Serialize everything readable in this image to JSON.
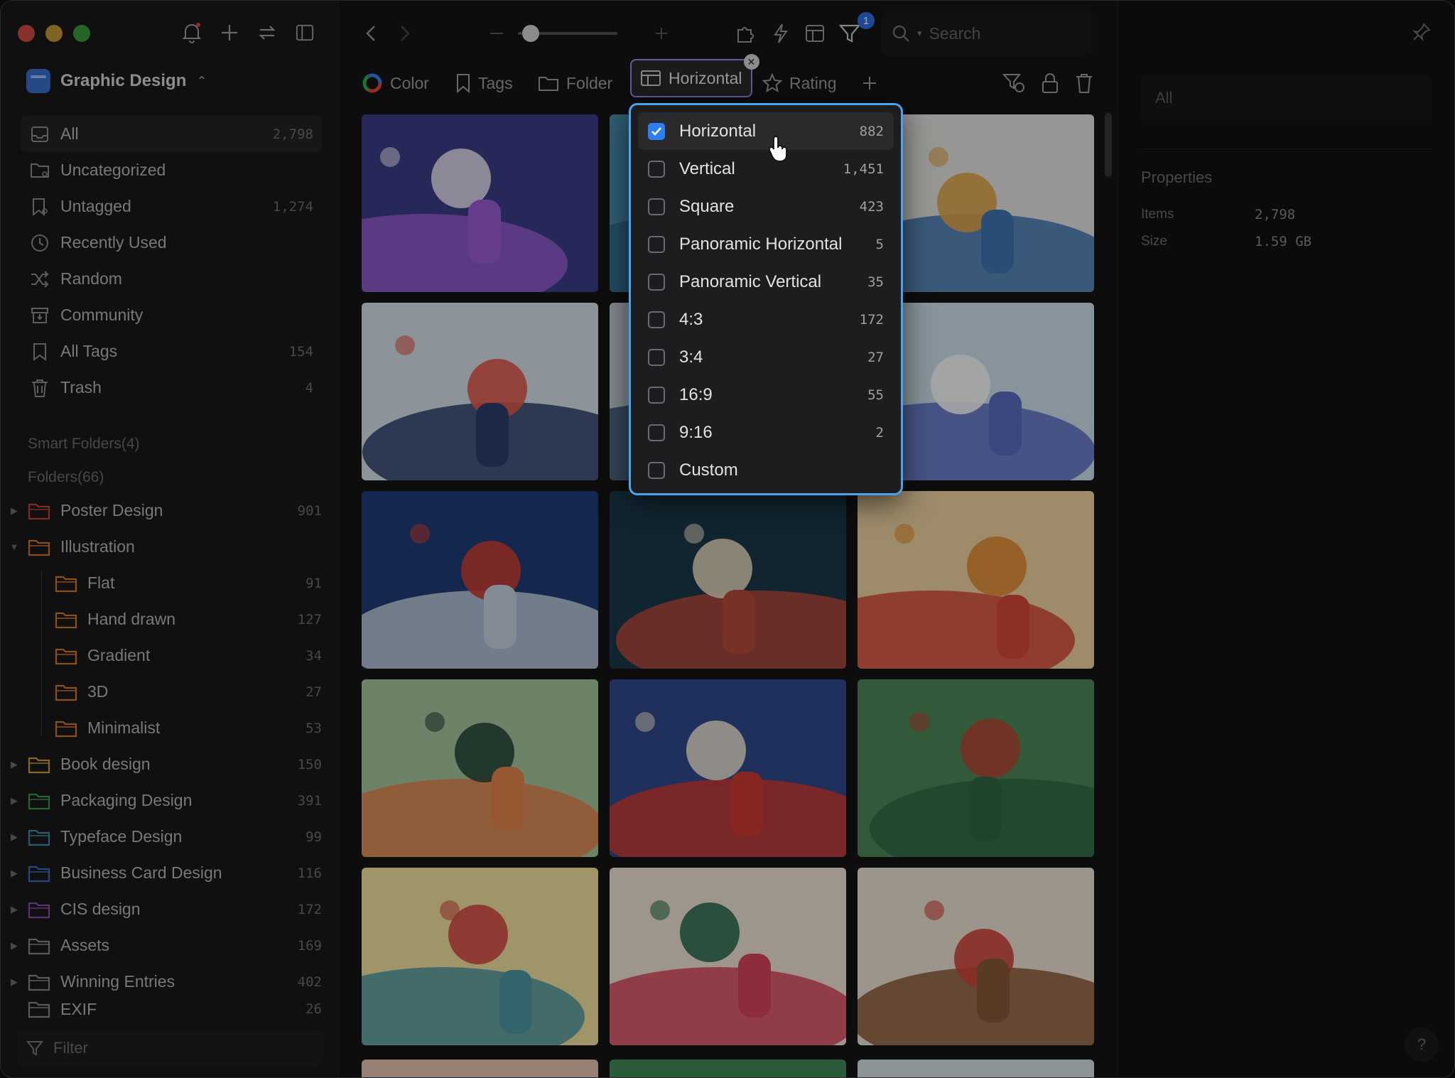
{
  "library": {
    "name": "Graphic Design"
  },
  "nav": [
    {
      "icon": "inbox-icon",
      "label": "All",
      "count": "2,798",
      "active": true
    },
    {
      "icon": "folder-question-icon",
      "label": "Uncategorized",
      "count": ""
    },
    {
      "icon": "tag-question-icon",
      "label": "Untagged",
      "count": "1,274"
    },
    {
      "icon": "clock-icon",
      "label": "Recently Used",
      "count": ""
    },
    {
      "icon": "shuffle-icon",
      "label": "Random",
      "count": ""
    },
    {
      "icon": "community-box-icon",
      "label": "Community",
      "count": ""
    },
    {
      "icon": "bookmark-icon",
      "label": "All Tags",
      "count": "154"
    },
    {
      "icon": "trash-icon",
      "label": "Trash",
      "count": "4"
    }
  ],
  "sections": {
    "smart_folders": "Smart Folders(4)",
    "folders": "Folders(66)"
  },
  "folders": [
    {
      "label": "Poster Design",
      "count": "901",
      "color": "#c0423f",
      "toggle": "right",
      "child": false
    },
    {
      "label": "Illustration",
      "count": "",
      "color": "#d47a2a",
      "toggle": "down",
      "child": false
    },
    {
      "label": "Flat",
      "count": "91",
      "color": "#d47a2a",
      "toggle": "",
      "child": true
    },
    {
      "label": "Hand drawn",
      "count": "127",
      "color": "#d47a2a",
      "toggle": "",
      "child": true
    },
    {
      "label": "Gradient",
      "count": "34",
      "color": "#d47a2a",
      "toggle": "",
      "child": true
    },
    {
      "label": "3D",
      "count": "27",
      "color": "#d47a2a",
      "toggle": "",
      "child": true
    },
    {
      "label": "Minimalist",
      "count": "53",
      "color": "#d47a2a",
      "toggle": "",
      "child": true
    },
    {
      "label": "Book design",
      "count": "150",
      "color": "#d3a12e",
      "toggle": "right",
      "child": false
    },
    {
      "label": "Packaging Design",
      "count": "391",
      "color": "#3f9a4a",
      "toggle": "right",
      "child": false
    },
    {
      "label": "Typeface Design",
      "count": "99",
      "color": "#3c8fb0",
      "toggle": "right",
      "child": false
    },
    {
      "label": "Business Card Design",
      "count": "116",
      "color": "#3a6fc0",
      "toggle": "right",
      "child": false
    },
    {
      "label": "CIS design",
      "count": "172",
      "color": "#8a4fb0",
      "toggle": "right",
      "child": false
    },
    {
      "label": "Assets",
      "count": "169",
      "color": "#8a8a8e",
      "toggle": "right",
      "child": false
    },
    {
      "label": "Winning Entries",
      "count": "402",
      "color": "#8a8a8e",
      "toggle": "right",
      "child": false
    },
    {
      "label": "EXIF",
      "count": "26",
      "color": "#8a8a8e",
      "toggle": "",
      "child": false
    }
  ],
  "filter_bar": {
    "placeholder": "Filter"
  },
  "toolbar": {
    "filter_badge": "1",
    "search_placeholder": "Search"
  },
  "filter_chips": {
    "color": "Color",
    "tags": "Tags",
    "folder": "Folder",
    "shape": "Horizontal",
    "rating": "Rating"
  },
  "dropdown": [
    {
      "label": "Horizontal",
      "count": "882",
      "checked": true
    },
    {
      "label": "Vertical",
      "count": "1,451",
      "checked": false
    },
    {
      "label": "Square",
      "count": "423",
      "checked": false
    },
    {
      "label": "Panoramic Horizontal",
      "count": "5",
      "checked": false
    },
    {
      "label": "Panoramic Vertical",
      "count": "35",
      "checked": false
    },
    {
      "label": "4:3",
      "count": "172",
      "checked": false
    },
    {
      "label": "3:4",
      "count": "27",
      "checked": false
    },
    {
      "label": "16:9",
      "count": "55",
      "checked": false
    },
    {
      "label": "9:16",
      "count": "2",
      "checked": false
    },
    {
      "label": "Custom",
      "count": "",
      "checked": false
    }
  ],
  "inspector": {
    "field": "All",
    "title": "Properties",
    "props": [
      {
        "key": "Items",
        "value": "2,798"
      },
      {
        "key": "Size",
        "value": "1.59 GB"
      }
    ],
    "help": "?"
  },
  "thumbnails": [
    {
      "name": "lavender-gazebo-illustration",
      "bg": "#3d3e8a",
      "fg": "#9b5fd6",
      "accent": "#e8e2f3"
    },
    {
      "name": "hidden-thumbnail",
      "bg": "#4a8fb2",
      "fg": "#2f6e8f",
      "accent": "#d9c27a"
    },
    {
      "name": "woman-relaxing-chair-illustration",
      "bg": "#e6e8e3",
      "fg": "#3f77b3",
      "accent": "#e3a64a"
    },
    {
      "name": "cow-working-laptop-illustration",
      "bg": "#d9e3ec",
      "fg": "#2c3e6b",
      "accent": "#e45a4e"
    },
    {
      "name": "hidden-thumbnail",
      "bg": "#c9d3dc",
      "fg": "#3a5678",
      "accent": "#e0b55a"
    },
    {
      "name": "cow-hiker-map-illustration",
      "bg": "#cfe4ef",
      "fg": "#5b6fc4",
      "accent": "#ffffff"
    },
    {
      "name": "fish-market-window-illustration",
      "bg": "#1f3c7a",
      "fg": "#c9d6e4",
      "accent": "#cc3e34"
    },
    {
      "name": "house-porch-night-illustration",
      "bg": "#1b3a4c",
      "fg": "#b94b3c",
      "accent": "#e8dbc2"
    },
    {
      "name": "woman-flowers-cat-illustration",
      "bg": "#f2d6a4",
      "fg": "#d84a3a",
      "accent": "#e58f34"
    },
    {
      "name": "couple-dancing-party-illustration",
      "bg": "#a7c9a0",
      "fg": "#e7864d",
      "accent": "#2b4a3a"
    },
    {
      "name": "drummer-horse-illustration",
      "bg": "#2f4a8c",
      "fg": "#d23b33",
      "accent": "#f0e6d6"
    },
    {
      "name": "lotus-pond-boat-illustration",
      "bg": "#4d8a5a",
      "fg": "#2f6b43",
      "accent": "#b84a3a"
    },
    {
      "name": "woman-dog-christmas-illustration",
      "bg": "#f6e3a2",
      "fg": "#4f9aa5",
      "accent": "#d94a45"
    },
    {
      "name": "woman-hugging-bear-illustration",
      "bg": "#f3e6d7",
      "fg": "#d9465b",
      "accent": "#2e6e4f"
    },
    {
      "name": "bear-crowd-street-illustration",
      "bg": "#efe5d8",
      "fg": "#8b5a3a",
      "accent": "#d2453a"
    }
  ]
}
